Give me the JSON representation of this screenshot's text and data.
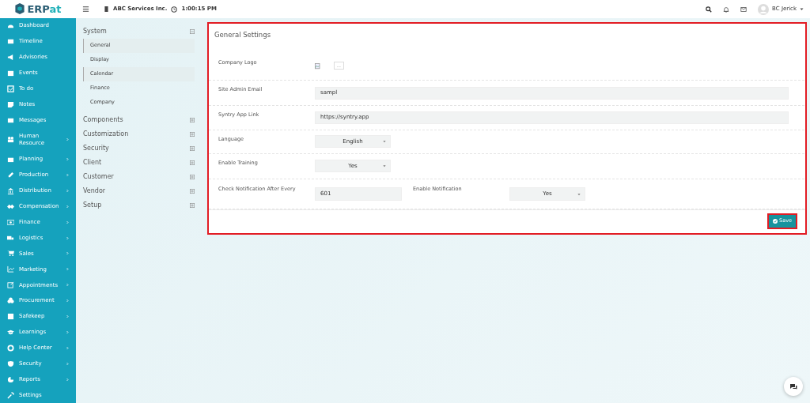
{
  "brand": {
    "name_start": "ERP",
    "name_end": "at"
  },
  "topbar": {
    "company": "ABC Services Inc.",
    "time": "1:00:15 PM",
    "user": "BC Jerick"
  },
  "sidebar": {
    "items": [
      {
        "label": "Dashboard",
        "has_submenu": false
      },
      {
        "label": "Timeline",
        "has_submenu": false
      },
      {
        "label": "Advisories",
        "has_submenu": false
      },
      {
        "label": "Events",
        "has_submenu": false
      },
      {
        "label": "To do",
        "has_submenu": false
      },
      {
        "label": "Notes",
        "has_submenu": false
      },
      {
        "label": "Messages",
        "has_submenu": false
      },
      {
        "label": "Human Resource",
        "has_submenu": true
      },
      {
        "label": "Planning",
        "has_submenu": true
      },
      {
        "label": "Production",
        "has_submenu": true
      },
      {
        "label": "Distribution",
        "has_submenu": true
      },
      {
        "label": "Compensation",
        "has_submenu": true
      },
      {
        "label": "Finance",
        "has_submenu": true
      },
      {
        "label": "Logistics",
        "has_submenu": true
      },
      {
        "label": "Sales",
        "has_submenu": true
      },
      {
        "label": "Marketing",
        "has_submenu": true
      },
      {
        "label": "Appointments",
        "has_submenu": true
      },
      {
        "label": "Procurement",
        "has_submenu": true
      },
      {
        "label": "Safekeep",
        "has_submenu": true
      },
      {
        "label": "Learnings",
        "has_submenu": true
      },
      {
        "label": "Help Center",
        "has_submenu": true
      },
      {
        "label": "Security",
        "has_submenu": true
      },
      {
        "label": "Reports",
        "has_submenu": true
      },
      {
        "label": "Settings",
        "has_submenu": false
      }
    ]
  },
  "settings_nav": [
    {
      "label": "System",
      "expanded": true,
      "children": [
        {
          "label": "General",
          "selected": true
        },
        {
          "label": "Display",
          "selected": false
        },
        {
          "label": "Calendar",
          "selected": true
        },
        {
          "label": "Finance",
          "selected": false
        },
        {
          "label": "Company",
          "selected": false
        }
      ]
    },
    {
      "label": "Components",
      "expanded": false
    },
    {
      "label": "Customization",
      "expanded": false
    },
    {
      "label": "Security",
      "expanded": false
    },
    {
      "label": "Client",
      "expanded": false
    },
    {
      "label": "Customer",
      "expanded": false
    },
    {
      "label": "Vendor",
      "expanded": false
    },
    {
      "label": "Setup",
      "expanded": false
    }
  ],
  "card": {
    "title": "General Settings",
    "highlighted": true,
    "rows": [
      {
        "kind": "logo",
        "label": "Company Logo",
        "button": "..."
      },
      {
        "kind": "text",
        "label": "Site Admin Email",
        "value": "sampl"
      },
      {
        "kind": "text",
        "label": "Syntry App Link",
        "value": "https://syntry.app"
      },
      {
        "kind": "select",
        "label": "Language",
        "value": "English"
      },
      {
        "kind": "select",
        "label": "Enable Training",
        "value": "Yes"
      },
      {
        "kind": "pair",
        "label": "Check Notification After Every",
        "value": "601",
        "label2": "Enable Notification",
        "value2": "Yes"
      }
    ],
    "save": {
      "label": "Save",
      "highlighted": true
    }
  }
}
